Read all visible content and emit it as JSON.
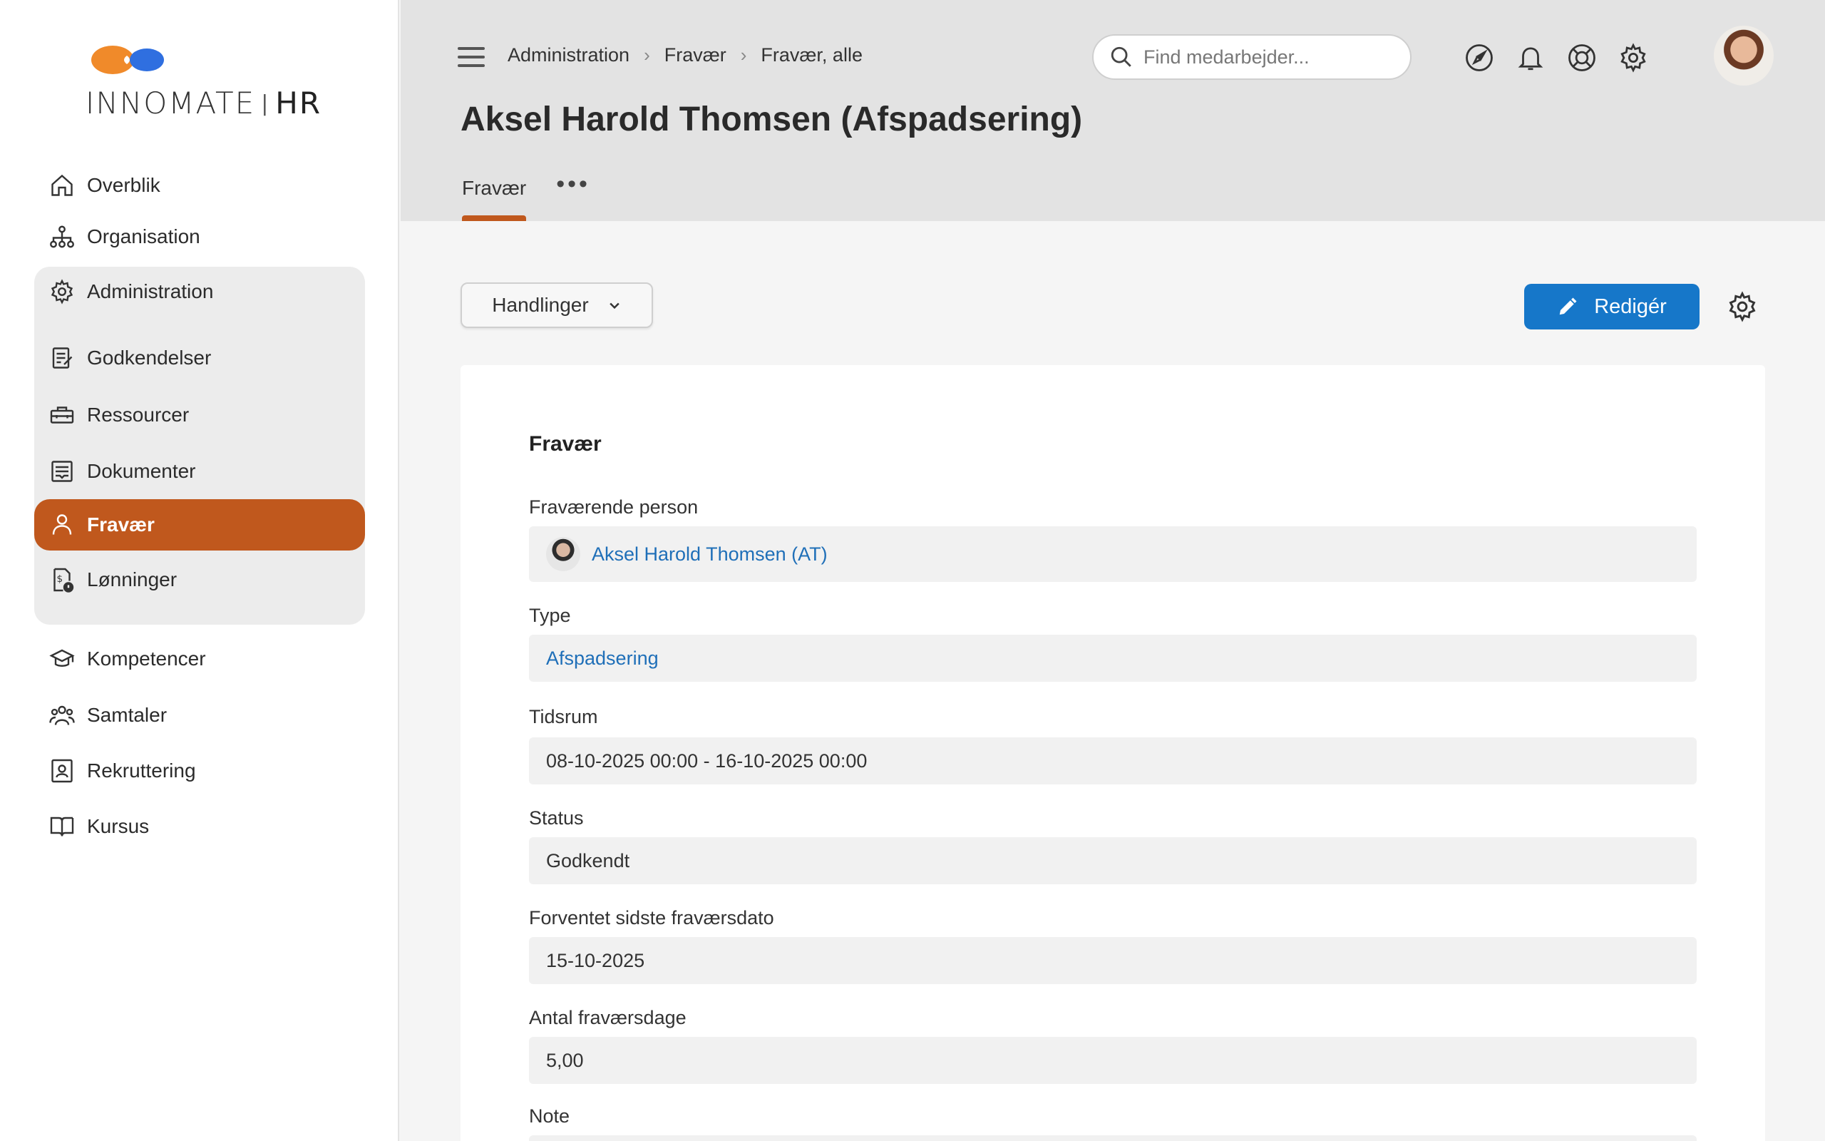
{
  "brand": {
    "name_left": "INNOMATE",
    "name_right": "HR",
    "accent": "#c0581d",
    "logo_orange": "#f08a2a",
    "logo_blue": "#2f6fe0"
  },
  "sidebar": {
    "items_top": [
      {
        "label": "Overblik",
        "icon": "home-icon"
      },
      {
        "label": "Organisation",
        "icon": "org-chart-icon"
      }
    ],
    "group": {
      "head": {
        "label": "Administration",
        "icon": "gear-icon"
      },
      "items": [
        {
          "label": "Godkendelser",
          "icon": "approval-icon"
        },
        {
          "label": "Ressourcer",
          "icon": "toolbox-icon"
        },
        {
          "label": "Dokumenter",
          "icon": "document-icon"
        },
        {
          "label": "Fravær",
          "icon": "person-icon",
          "active": true
        },
        {
          "label": "Lønninger",
          "icon": "payroll-icon"
        }
      ]
    },
    "items_bottom": [
      {
        "label": "Kompetencer",
        "icon": "graduation-cap-icon"
      },
      {
        "label": "Samtaler",
        "icon": "people-icon"
      },
      {
        "label": "Rekruttering",
        "icon": "badge-icon"
      },
      {
        "label": "Kursus",
        "icon": "book-icon"
      }
    ]
  },
  "header": {
    "breadcrumb": [
      "Administration",
      "Fravær",
      "Fravær, alle"
    ],
    "search_placeholder": "Find medarbejder...",
    "title": "Aksel Harold Thomsen (Afspadsering)",
    "tabs": [
      {
        "label": "Fravær",
        "active": true
      }
    ],
    "more_label": "•••"
  },
  "toolbar": {
    "actions_label": "Handlinger",
    "edit_label": "Redigér",
    "edit_color": "#1677c9"
  },
  "card": {
    "section_title": "Fravær",
    "fields": {
      "person": {
        "label": "Fraværende person",
        "value": "Aksel Harold Thomsen (AT)"
      },
      "type": {
        "label": "Type",
        "value": "Afspadsering"
      },
      "period": {
        "label": "Tidsrum",
        "value": "08-10-2025 00:00 - 16-10-2025 00:00"
      },
      "status": {
        "label": "Status",
        "value": "Godkendt"
      },
      "expected_last": {
        "label": "Forventet sidste fraværsdato",
        "value": "15-10-2025"
      },
      "days": {
        "label": "Antal fraværsdage",
        "value": "5,00"
      },
      "note": {
        "label": "Note"
      }
    }
  }
}
